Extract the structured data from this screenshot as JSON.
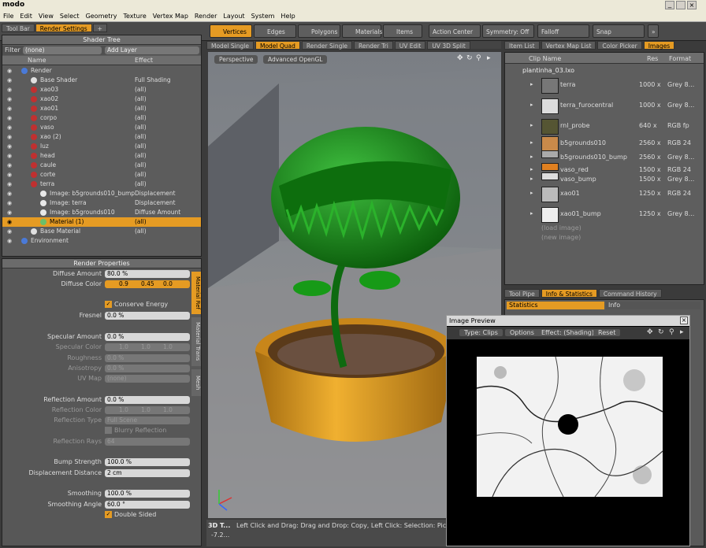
{
  "app": {
    "title": "modo"
  },
  "menu": [
    "File",
    "Edit",
    "View",
    "Select",
    "Geometry",
    "Texture",
    "Vertex Map",
    "Render",
    "Layout",
    "System",
    "Help"
  ],
  "left_tabs": [
    "Tool Bar",
    "Render Settings"
  ],
  "toolbar": {
    "modes": [
      "Vertices",
      "Edges",
      "Polygons",
      "Materials",
      "Items"
    ],
    "action_center": "Action Center",
    "symmetry": "Symmetry: Off",
    "falloff": "Falloff",
    "snap": "Snap"
  },
  "shader_tree": {
    "title": "Shader Tree",
    "filter_label": "Filter",
    "filter_value": "(none)",
    "add_layer": "Add Layer",
    "col_name": "Name",
    "col_effect": "Effect",
    "rows": [
      {
        "name": "Render",
        "effect": ""
      },
      {
        "name": "Base Shader",
        "effect": "Full Shading"
      },
      {
        "name": "xao03",
        "effect": "(all)"
      },
      {
        "name": "xao02",
        "effect": "(all)"
      },
      {
        "name": "xao01",
        "effect": "(all)"
      },
      {
        "name": "corpo",
        "effect": "(all)"
      },
      {
        "name": "vaso",
        "effect": "(all)"
      },
      {
        "name": "xao (2)",
        "effect": "(all)"
      },
      {
        "name": "luz",
        "effect": "(all)"
      },
      {
        "name": "head",
        "effect": "(all)"
      },
      {
        "name": "caule",
        "effect": "(all)"
      },
      {
        "name": "corte",
        "effect": "(all)"
      },
      {
        "name": "terra",
        "effect": "(all)"
      },
      {
        "name": "Image: b5grounds010_bump",
        "effect": "Displacement"
      },
      {
        "name": "Image: terra",
        "effect": "Displacement"
      },
      {
        "name": "Image: b5grounds010",
        "effect": "Diffuse Amount"
      },
      {
        "name": "Material (1)",
        "effect": "(all)"
      },
      {
        "name": "Base Material",
        "effect": "(all)"
      },
      {
        "name": "Environment",
        "effect": ""
      }
    ]
  },
  "render_props": {
    "title": "Render Properties",
    "side_tabs": [
      "Material Ref",
      "Material Trans",
      "Mesh"
    ],
    "diffuse_amount_label": "Diffuse Amount",
    "diffuse_amount": "80.0 %",
    "diffuse_color_label": "Diffuse Color",
    "diffuse_color": [
      "0.9",
      "0.45",
      "0.0"
    ],
    "conserve_energy": "Conserve Energy",
    "fresnel_label": "Fresnel",
    "fresnel": "0.0 %",
    "specular_amount_label": "Specular Amount",
    "specular_amount": "0.0 %",
    "specular_color_label": "Specular Color",
    "specular_color": [
      "1.0",
      "1.0",
      "1.0"
    ],
    "roughness_label": "Roughness",
    "roughness": "0.0 %",
    "anisotropy_label": "Anisotropy",
    "anisotropy": "0.0 %",
    "uvmap_label": "UV Map",
    "uvmap": "(none)",
    "reflection_amount_label": "Reflection Amount",
    "reflection_amount": "0.0 %",
    "reflection_color_label": "Reflection Color",
    "reflection_color": [
      "1.0",
      "1.0",
      "1.0"
    ],
    "reflection_type_label": "Reflection Type",
    "reflection_type": "Full Scene",
    "blurry_reflection": "Blurry Reflection",
    "reflection_rays_label": "Reflection Rays",
    "reflection_rays": "64",
    "bump_strength_label": "Bump Strength",
    "bump_strength": "100.0 %",
    "displacement_label": "Displacement Distance",
    "displacement": "2 cm",
    "smoothing_label": "Smoothing",
    "smoothing": "100.0 %",
    "smoothing_angle_label": "Smoothing Angle",
    "smoothing_angle": "60.0 °",
    "double_sided": "Double Sided"
  },
  "viewport": {
    "tabs": [
      "Model Single",
      "Model Quad",
      "Render Single",
      "Render Tri",
      "UV Edit",
      "UV 3D Split"
    ],
    "view": "Perspective",
    "shading": "Advanced OpenGL"
  },
  "right_tabs": [
    "Item List",
    "Vertex Map List",
    "Color Picker",
    "Images"
  ],
  "clips": {
    "col_name": "Clip Name",
    "col_res": "Res",
    "col_format": "Format",
    "file": "plantinha_03.lxo",
    "rows": [
      {
        "name": "terra",
        "res": "1000 x",
        "format": "Grey 8..."
      },
      {
        "name": "terra_furocentral",
        "res": "1000 x",
        "format": "Grey 8..."
      },
      {
        "name": "rnl_probe",
        "res": "640 x",
        "format": "RGB fp"
      },
      {
        "name": "b5grounds010",
        "res": "2560 x",
        "format": "RGB 24"
      },
      {
        "name": "b5grounds010_bump",
        "res": "2560 x",
        "format": "Grey 8..."
      },
      {
        "name": "vaso_red",
        "res": "1500 x",
        "format": "RGB 24"
      },
      {
        "name": "vaso_bump",
        "res": "1500 x",
        "format": "Grey 8..."
      },
      {
        "name": "xao01",
        "res": "1250 x",
        "format": "RGB 24"
      },
      {
        "name": "xao01_bump",
        "res": "1250 x",
        "format": "Grey 8..."
      }
    ],
    "load": "(load image)",
    "new": "(new image)"
  },
  "bottom_tabs": [
    "Tool Pipe",
    "Info & Statistics",
    "Command History"
  ],
  "stats": {
    "statistics": "Statistics",
    "info": "Info"
  },
  "preview": {
    "title": "Image Preview",
    "type": "Type: Clips",
    "options": "Options",
    "effect": "Effect: (Shading)",
    "reset": "Reset"
  },
  "status": {
    "label": "3D T...",
    "value": "-7.2...",
    "hint": "Left Click and Drag: Drag and Drop: Copy, Left Click: Selection: Pick, [Any Key]"
  }
}
